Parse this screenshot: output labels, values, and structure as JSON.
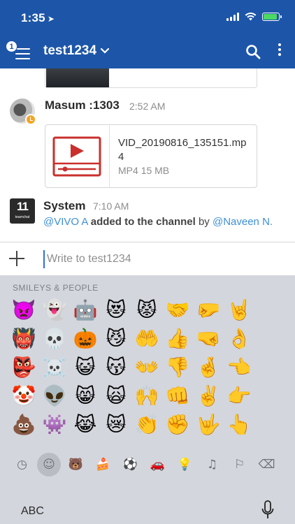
{
  "status_bar": {
    "time": "1:35",
    "location_glyph": "➤",
    "battery_level": 0.9
  },
  "header": {
    "unread_badge": "1",
    "channel_title": "test1234"
  },
  "messages": [
    {
      "author": "Masum :1303",
      "time": "2:52 AM",
      "attachment": {
        "file_name": "VID_20190816_135151.mp4",
        "type_label": "MP4",
        "size": "15 MB"
      }
    },
    {
      "author": "System",
      "time": "7:10 AM",
      "logo_text": "11",
      "logo_sub": "teamchat",
      "text_parts": {
        "mention_user": "@VIVO A",
        "action": "added to the channel",
        "by": "by",
        "mention_actor": "@Naveen N."
      }
    }
  ],
  "input": {
    "placeholder": "Write to test1234"
  },
  "keyboard": {
    "section_label": "SMILEYS & PEOPLE",
    "emojis": [
      "👿",
      "👻",
      "🤖",
      "😻",
      "😾",
      "🤝",
      "🤛",
      "🤘",
      "",
      "👹",
      "💀",
      "🎃",
      "😼",
      "🤲",
      "👍",
      "🤜",
      "👌",
      "",
      "👺",
      "☠️",
      "😺",
      "😽",
      "👐",
      "👎",
      "🤞",
      "👈",
      "",
      "🤡",
      "👽",
      "😸",
      "🙀",
      "🙌",
      "👊",
      "✌️",
      "👉",
      "",
      "💩",
      "👾",
      "😹",
      "😿",
      "👏",
      "✊",
      "🤟",
      "👆",
      ""
    ],
    "categories": [
      {
        "name": "recent-icon",
        "glyph": "◷"
      },
      {
        "name": "smileys-icon",
        "glyph": "☺"
      },
      {
        "name": "animals-icon",
        "glyph": "🐻"
      },
      {
        "name": "food-icon",
        "glyph": "🍰"
      },
      {
        "name": "activity-icon",
        "glyph": "⚽"
      },
      {
        "name": "travel-icon",
        "glyph": "🚗"
      },
      {
        "name": "objects-icon",
        "glyph": "💡"
      },
      {
        "name": "symbols-icon",
        "glyph": "♫"
      },
      {
        "name": "flags-icon",
        "glyph": "⚐"
      },
      {
        "name": "backspace-icon",
        "glyph": "⌫"
      }
    ],
    "abc_label": "ABC"
  },
  "colors": {
    "brand": "#1d56a8",
    "mention": "#3d8fd6",
    "video_red": "#c9302c",
    "keyboard_bg": "#d3d6dc"
  }
}
